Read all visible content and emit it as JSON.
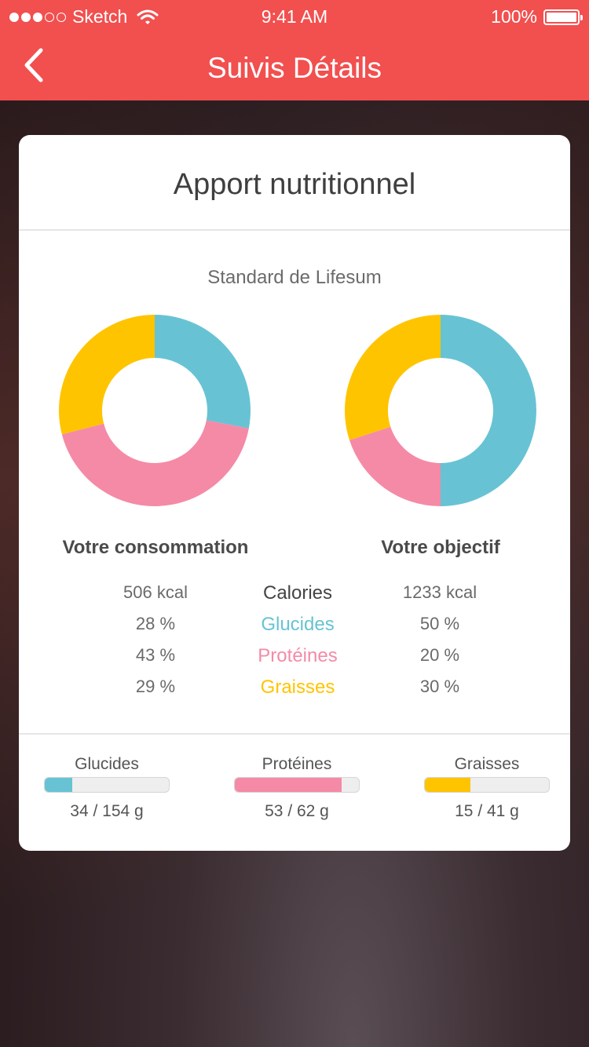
{
  "status_bar": {
    "carrier": "Sketch",
    "time": "9:41 AM",
    "battery": "100%"
  },
  "nav": {
    "title": "Suivis Détails",
    "back_icon": "chevron-left-icon"
  },
  "card": {
    "title": "Apport nutritionnel",
    "subtitle": "Standard de Lifesum",
    "consumption_label": "Votre consommation",
    "objective_label": "Votre objectif"
  },
  "colors": {
    "header": "#f24f4f",
    "glucides": "#67c3d4",
    "proteines": "#f58aa6",
    "graisses": "#ffc400"
  },
  "chart_data": [
    {
      "type": "pie",
      "categories": [
        "Glucides",
        "Protéines",
        "Graisses"
      ],
      "values": [
        28,
        43,
        29
      ]
    },
    {
      "type": "pie",
      "categories": [
        "Glucides",
        "Protéines",
        "Graisses"
      ],
      "values": [
        50,
        20,
        30
      ]
    }
  ],
  "stats": [
    {
      "left": "506 kcal",
      "label": "Calories",
      "right": "1233 kcal",
      "color": "#444444"
    },
    {
      "left": "28 %",
      "label": "Glucides",
      "right": "50 %",
      "color": "#67c3d4"
    },
    {
      "left": "43 %",
      "label": "Protéines",
      "right": "20 %",
      "color": "#f58aa6"
    },
    {
      "left": "29 %",
      "label": "Graisses",
      "right": "30 %",
      "color": "#ffc400"
    }
  ],
  "bars": [
    {
      "label": "Glucides",
      "value": "34 / 154 g",
      "fraction": 0.22,
      "color": "#67c3d4"
    },
    {
      "label": "Protéines",
      "value": "53 / 62 g",
      "fraction": 0.86,
      "color": "#f58aa6"
    },
    {
      "label": "Graisses",
      "value": "15 / 41 g",
      "fraction": 0.37,
      "color": "#ffc400"
    }
  ]
}
